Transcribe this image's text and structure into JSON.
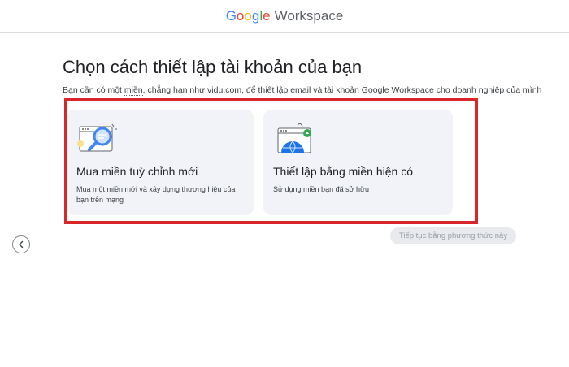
{
  "header": {
    "logo_google": "Google",
    "logo_workspace": "Workspace"
  },
  "page": {
    "title": "Chọn cách thiết lập tài khoản của bạn",
    "subtitle_pre": "Bạn cần có một ",
    "subtitle_link": "miền",
    "subtitle_post": ", chẳng hạn như vidu.com, để thiết lập email và tài khoản Google Workspace cho doanh nghiệp của mình"
  },
  "options": [
    {
      "title": "Mua miền tuỳ chỉnh mới",
      "description": "Mua một miền mới và xây dựng thương hiệu của bạn trên mạng",
      "icon": "domain-search-icon"
    },
    {
      "title": "Thiết lập bằng miền hiện có",
      "description": "Sử dụng miền bạn đã sở hữu",
      "icon": "globe-website-icon"
    }
  ],
  "actions": {
    "continue_label": "Tiếp tục bằng phương thức này",
    "back_icon": "chevron-left-icon"
  },
  "colors": {
    "highlight_border": "#d9262b",
    "card_bg": "#f1f3f8",
    "google_blue": "#4285f4",
    "google_red": "#ea4335",
    "google_yellow": "#fbbc04",
    "google_green": "#34a853"
  }
}
